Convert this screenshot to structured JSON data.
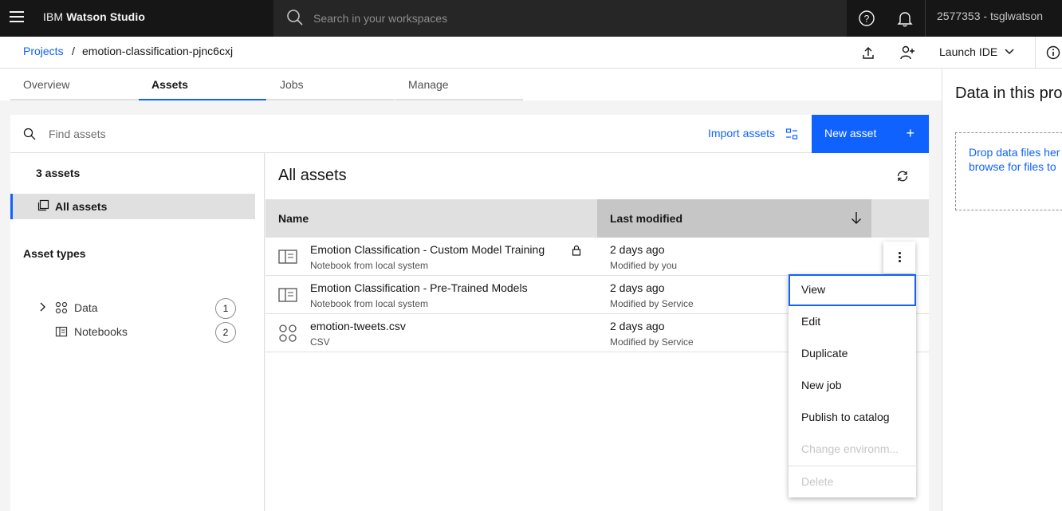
{
  "topbar": {
    "brand_prefix": "IBM",
    "brand_name": "Watson Studio",
    "search_placeholder": "Search in your workspaces",
    "account": "2577353 - tsglwatson"
  },
  "breadcrumb": {
    "root": "Projects",
    "separator": "/",
    "current": "emotion-classification-pjnc6cxj",
    "launch_ide": "Launch IDE"
  },
  "tabs": [
    {
      "label": "Overview"
    },
    {
      "label": "Assets"
    },
    {
      "label": "Jobs"
    },
    {
      "label": "Manage"
    }
  ],
  "toolbar": {
    "find_placeholder": "Find assets",
    "import_label": "Import assets",
    "new_asset_label": "New asset",
    "new_asset_plus": "+"
  },
  "filters": {
    "count": "3 assets",
    "all_assets": "All assets",
    "asset_types_title": "Asset types",
    "types": [
      {
        "label": "Data",
        "count": "1"
      },
      {
        "label": "Notebooks",
        "count": "2"
      }
    ]
  },
  "main": {
    "title": "All assets",
    "columns": {
      "name": "Name",
      "modified": "Last modified"
    },
    "rows": [
      {
        "name": "Emotion Classification - Custom Model Training",
        "type": "Notebook from local system",
        "date": "2 days ago",
        "by": "Modified by you",
        "icon": "notebook-icon"
      },
      {
        "name": "Emotion Classification - Pre-Trained Models",
        "type": "Notebook from local system",
        "date": "2 days ago",
        "by": "Modified by Service",
        "icon": "notebook-icon"
      },
      {
        "name": "emotion-tweets.csv",
        "type": "CSV",
        "date": "2 days ago",
        "by": "Modified by Service",
        "icon": "data-icon"
      }
    ]
  },
  "menu": {
    "items": [
      {
        "label": "View",
        "state": "focused"
      },
      {
        "label": "Edit",
        "state": "enabled"
      },
      {
        "label": "Duplicate",
        "state": "enabled"
      },
      {
        "label": "New job",
        "state": "enabled"
      },
      {
        "label": "Publish to catalog",
        "state": "enabled"
      },
      {
        "label": "Change environm...",
        "state": "disabled"
      },
      {
        "label": "Delete",
        "state": "disabled"
      }
    ]
  },
  "right_panel": {
    "title": "Data in this pro",
    "drop_line1": "Drop data files her",
    "drop_line2": "browse for files to"
  },
  "colors": {
    "accent": "#0f62fe",
    "topbar": "#161616",
    "workarea": "#f4f4f4"
  }
}
